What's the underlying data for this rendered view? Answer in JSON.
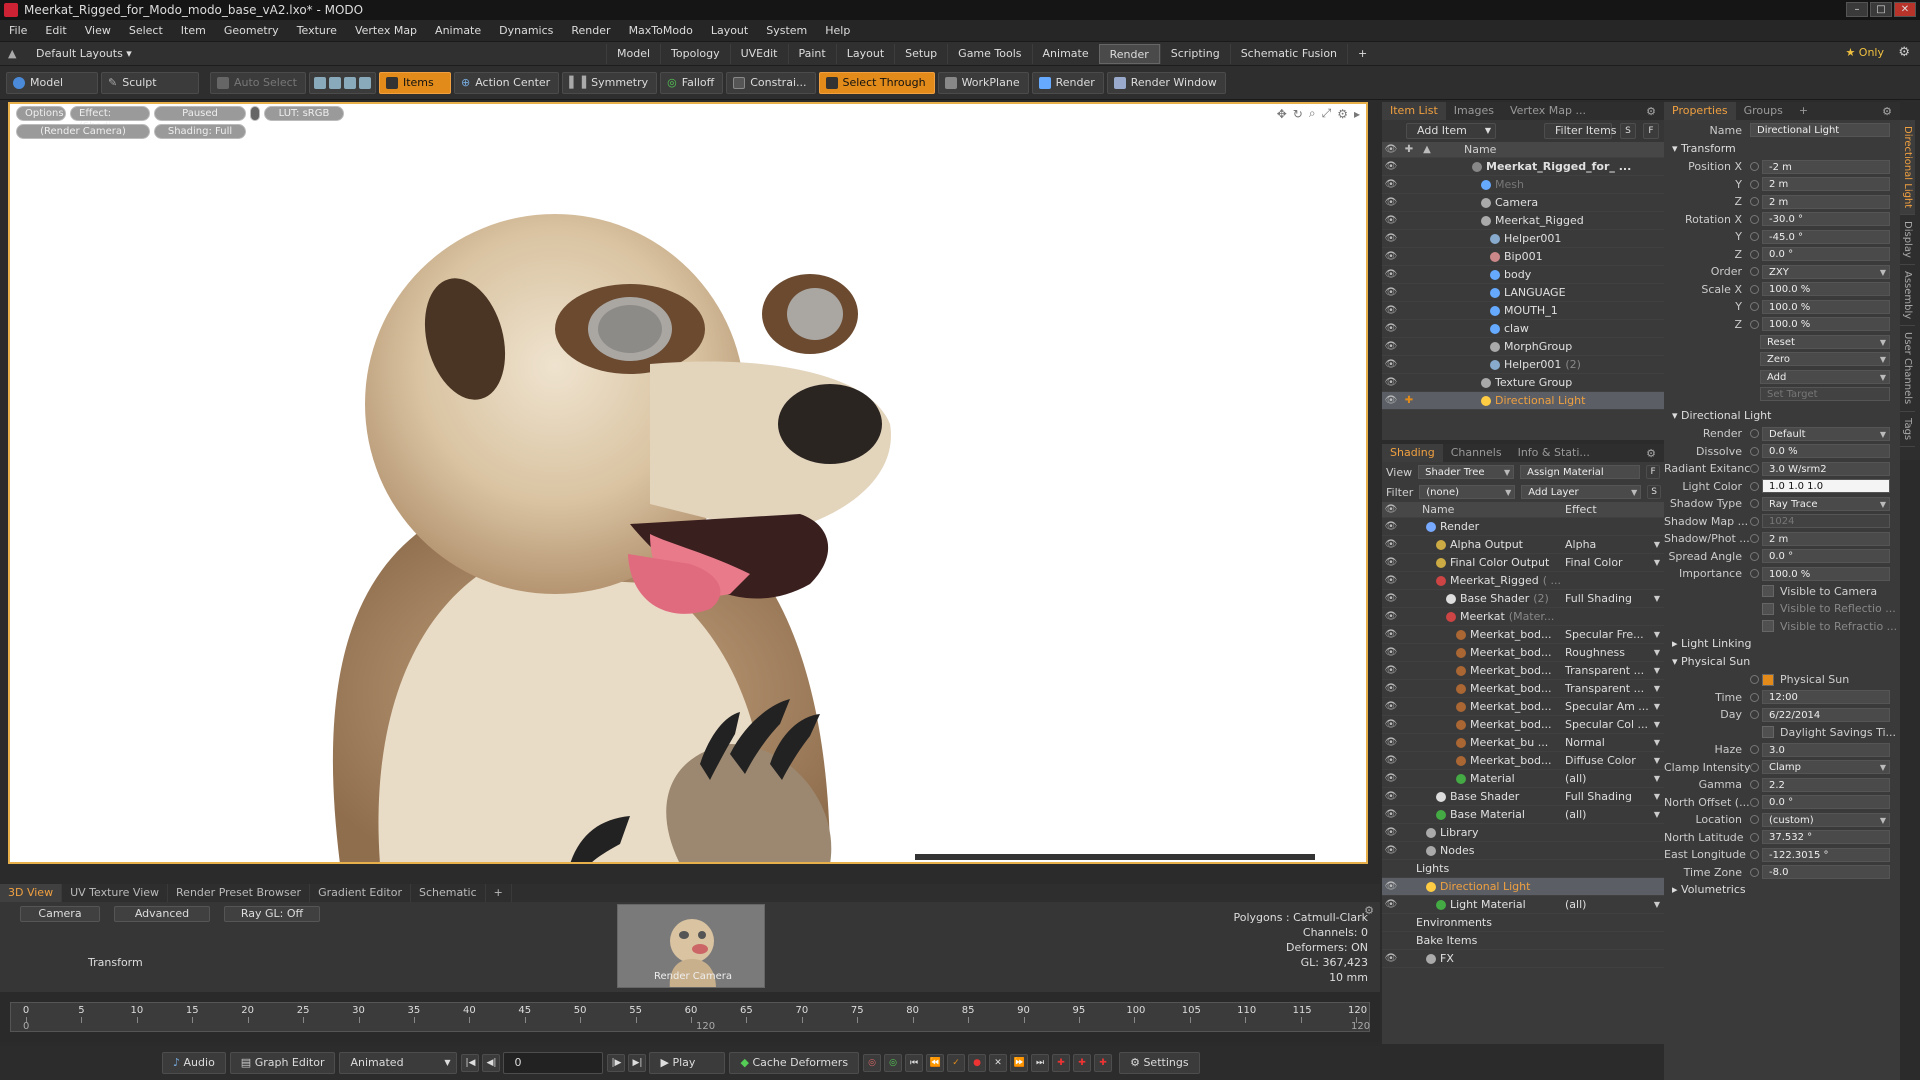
{
  "window": {
    "title": "Meerkat_Rigged_for_Modo_modo_base_vA2.lxo* - MODO"
  },
  "menu": [
    "File",
    "Edit",
    "View",
    "Select",
    "Item",
    "Geometry",
    "Texture",
    "Vertex Map",
    "Animate",
    "Dynamics",
    "Render",
    "MaxToModo",
    "Layout",
    "System",
    "Help"
  ],
  "layout": {
    "preset": "Default Layouts ▾",
    "tabs": [
      "Model",
      "Topology",
      "UVEdit",
      "Paint",
      "Layout",
      "Setup",
      "Game Tools",
      "Animate",
      "Render",
      "Scripting",
      "Schematic Fusion",
      "+"
    ],
    "active_tab": "Render",
    "only_label": "★ Only"
  },
  "toolbar": {
    "model": "Model",
    "sculpt": "Sculpt",
    "auto_select": "Auto Select",
    "items": "Items",
    "action_center": "Action Center",
    "symmetry": "Symmetry",
    "falloff": "Falloff",
    "constrain": "Constrai...",
    "select_through": "Select Through",
    "workplane": "WorkPlane",
    "render": "Render",
    "render_window": "Render Window"
  },
  "viewport": {
    "pills": [
      "Options",
      "Effect: (Shadi...",
      "Paused",
      "LUT: sRGB"
    ],
    "pills2": [
      "(Render Camera)",
      "Shading: Full"
    ]
  },
  "bottom_tabs": [
    "3D View",
    "UV Texture View",
    "Render Preset Browser",
    "Gradient Editor",
    "Schematic",
    "+"
  ],
  "bottom_panel": {
    "buttons": [
      "Camera",
      "Advanced",
      "Ray GL: Off"
    ],
    "transform": "Transform",
    "thumb_label": "Render Camera",
    "stats": [
      "Polygons : Catmull-Clark",
      "Channels: 0",
      "Deformers: ON",
      "GL: 367,423",
      "10 mm"
    ]
  },
  "timeline": {
    "ticks": [
      "0",
      "5",
      "10",
      "15",
      "20",
      "25",
      "30",
      "35",
      "40",
      "45",
      "50",
      "55",
      "60",
      "65",
      "70",
      "75",
      "80",
      "85",
      "90",
      "95",
      "100",
      "105",
      "110",
      "115",
      "120"
    ],
    "sub_left": "0",
    "sub_mid": "120",
    "sub_right": "120"
  },
  "transport": {
    "audio": "Audio",
    "graph_editor": "Graph Editor",
    "animated": "Animated",
    "frame": "0",
    "play": "Play",
    "cache": "Cache Deformers",
    "settings": "Settings"
  },
  "item_list": {
    "tabs": [
      "Item List",
      "Images",
      "Vertex Map ..."
    ],
    "add_item": "Add Item",
    "filter_items": "Filter Items",
    "s": "S",
    "f": "F",
    "header_name": "Name",
    "rows": [
      {
        "indent": 4,
        "name": "Meerkat_Rigged_for_ ...",
        "bold": true,
        "icon": "#888"
      },
      {
        "indent": 5,
        "name": "Mesh",
        "dim": true,
        "icon": "#6af"
      },
      {
        "indent": 5,
        "name": "Camera",
        "icon": "#aaa"
      },
      {
        "indent": 5,
        "name": "Meerkat_Rigged",
        "icon": "#aaa"
      },
      {
        "indent": 6,
        "name": "Helper001",
        "icon": "#8ac"
      },
      {
        "indent": 6,
        "name": "Bip001",
        "icon": "#c88"
      },
      {
        "indent": 6,
        "name": "body",
        "icon": "#6af"
      },
      {
        "indent": 6,
        "name": "LANGUAGE",
        "icon": "#6af"
      },
      {
        "indent": 6,
        "name": "MOUTH_1",
        "icon": "#6af"
      },
      {
        "indent": 6,
        "name": "claw",
        "icon": "#6af"
      },
      {
        "indent": 6,
        "name": "MorphGroup",
        "icon": "#aaa"
      },
      {
        "indent": 6,
        "name": "Helper001",
        "suffix": "(2)",
        "icon": "#8ac"
      },
      {
        "indent": 5,
        "name": "Texture Group",
        "icon": "#aaa"
      },
      {
        "indent": 5,
        "name": "Directional Light",
        "sel": true,
        "icon": "#fc4"
      }
    ]
  },
  "shading": {
    "tabs": [
      "Shading",
      "Channels",
      "Info & Stati..."
    ],
    "view_label": "View",
    "view_value": "Shader Tree",
    "assign_material": "Assign Material",
    "filter_label": "Filter",
    "filter_value": "(none)",
    "add_layer": "Add Layer",
    "header_name": "Name",
    "header_effect": "Effect",
    "rows": [
      {
        "indent": 2,
        "name": "Render",
        "effect": "",
        "icon": "#7af"
      },
      {
        "indent": 3,
        "name": "Alpha Output",
        "effect": "Alpha",
        "icon": "#ca4"
      },
      {
        "indent": 3,
        "name": "Final Color Output",
        "effect": "Final Color",
        "icon": "#ca4"
      },
      {
        "indent": 3,
        "name": "Meerkat_Rigged",
        "suffix": "( ...",
        "effect": "",
        "icon": "#c44"
      },
      {
        "indent": 4,
        "name": "Base Shader",
        "suffix": "(2)",
        "effect": "Full Shading",
        "icon": "#ddd"
      },
      {
        "indent": 4,
        "name": "Meerkat",
        "suffix": "(Mater...",
        "effect": "",
        "icon": "#c44"
      },
      {
        "indent": 5,
        "name": "Meerkat_bod...",
        "effect": "Specular Fre...",
        "icon": "#a63"
      },
      {
        "indent": 5,
        "name": "Meerkat_bod...",
        "effect": "Roughness",
        "icon": "#a63"
      },
      {
        "indent": 5,
        "name": "Meerkat_bod...",
        "effect": "Transparent ...",
        "icon": "#a63"
      },
      {
        "indent": 5,
        "name": "Meerkat_bod...",
        "effect": "Transparent ...",
        "icon": "#a63"
      },
      {
        "indent": 5,
        "name": "Meerkat_bod...",
        "effect": "Specular Am ...",
        "icon": "#a63"
      },
      {
        "indent": 5,
        "name": "Meerkat_bod...",
        "effect": "Specular Col ...",
        "icon": "#a63"
      },
      {
        "indent": 5,
        "name": "Meerkat_bu ...",
        "effect": "Normal",
        "icon": "#a63"
      },
      {
        "indent": 5,
        "name": "Meerkat_bod...",
        "effect": "Diffuse Color",
        "icon": "#a63"
      },
      {
        "indent": 5,
        "name": "Material",
        "effect": "(all)",
        "icon": "#4a4"
      },
      {
        "indent": 3,
        "name": "Base Shader",
        "effect": "Full Shading",
        "icon": "#ddd"
      },
      {
        "indent": 3,
        "name": "Base Material",
        "effect": "(all)",
        "icon": "#4a4"
      },
      {
        "indent": 2,
        "name": "Library",
        "effect": "",
        "icon": "#aaa"
      },
      {
        "indent": 2,
        "name": "Nodes",
        "effect": "",
        "icon": "#aaa"
      },
      {
        "indent": 1,
        "name": "Lights",
        "effect": "",
        "icon": ""
      },
      {
        "indent": 2,
        "name": "Directional Light",
        "effect": "",
        "sel": true,
        "icon": "#fc4"
      },
      {
        "indent": 3,
        "name": "Light Material",
        "effect": "(all)",
        "icon": "#4a4"
      },
      {
        "indent": 1,
        "name": "Environments",
        "effect": "",
        "icon": ""
      },
      {
        "indent": 1,
        "name": "Bake Items",
        "effect": "",
        "icon": ""
      },
      {
        "indent": 2,
        "name": "FX",
        "effect": "",
        "icon": "#aaa"
      }
    ]
  },
  "properties": {
    "tabs": [
      "Properties",
      "Groups",
      "+"
    ],
    "name_label": "Name",
    "name_value": "Directional Light",
    "transform_section": "Transform",
    "transform": [
      {
        "label": "Position X",
        "value": "-2 m"
      },
      {
        "label": "Y",
        "value": "2 m"
      },
      {
        "label": "Z",
        "value": "2 m"
      },
      {
        "label": "Rotation X",
        "value": "-30.0 °"
      },
      {
        "label": "Y",
        "value": "-45.0 °"
      },
      {
        "label": "Z",
        "value": "0.0 °"
      },
      {
        "label": "Order",
        "value": "ZXY",
        "dd": true
      },
      {
        "label": "Scale X",
        "value": "100.0 %"
      },
      {
        "label": "Y",
        "value": "100.0 %"
      },
      {
        "label": "Z",
        "value": "100.0 %"
      }
    ],
    "transform_buttons": [
      "Reset",
      "Zero",
      "Add",
      "Set Target"
    ],
    "light_section": "Directional Light",
    "light": [
      {
        "label": "Render",
        "value": "Default",
        "dd": true
      },
      {
        "label": "Dissolve",
        "value": "0.0 %"
      },
      {
        "label": "Radiant Exitance",
        "value": "3.0 W/srm2"
      },
      {
        "label": "Light Color",
        "value": "1.0     1.0     1.0",
        "white": true
      },
      {
        "label": "Shadow Type",
        "value": "Ray Trace",
        "dd": true
      },
      {
        "label": "Shadow Map ...",
        "value": "1024",
        "dis": true
      },
      {
        "label": "Shadow/Phot ...",
        "value": "2 m"
      },
      {
        "label": "Spread Angle",
        "value": "0.0 °"
      },
      {
        "label": "Importance",
        "value": "100.0 %"
      }
    ],
    "light_checks": [
      "Visible to Camera",
      "Visible to Reflectio ...",
      "Visible to Refractio ..."
    ],
    "light_linking": "Light Linking",
    "sun_section": "Physical Sun",
    "physical_sun": "Physical Sun",
    "sun": [
      {
        "label": "Time",
        "value": "12:00"
      },
      {
        "label": "Day",
        "value": "6/22/2014"
      }
    ],
    "daylight": "Daylight Savings Ti...",
    "sun2": [
      {
        "label": "Haze",
        "value": "3.0"
      },
      {
        "label": "Clamp Intensity",
        "value": "Clamp",
        "dd": true
      },
      {
        "label": "Gamma",
        "value": "2.2"
      },
      {
        "label": "North Offset (...",
        "value": "0.0 °"
      },
      {
        "label": "Location",
        "value": "(custom)",
        "dd": true
      },
      {
        "label": "North Latitude",
        "value": "37.532 °"
      },
      {
        "label": "East Longitude",
        "value": "-122.3015 °"
      },
      {
        "label": "Time Zone",
        "value": "-8.0"
      }
    ],
    "volumetrics": "Volumetrics"
  },
  "side_tabs": [
    "Directional Light",
    "Display",
    "Assembly",
    "User Channels",
    "Tags"
  ]
}
